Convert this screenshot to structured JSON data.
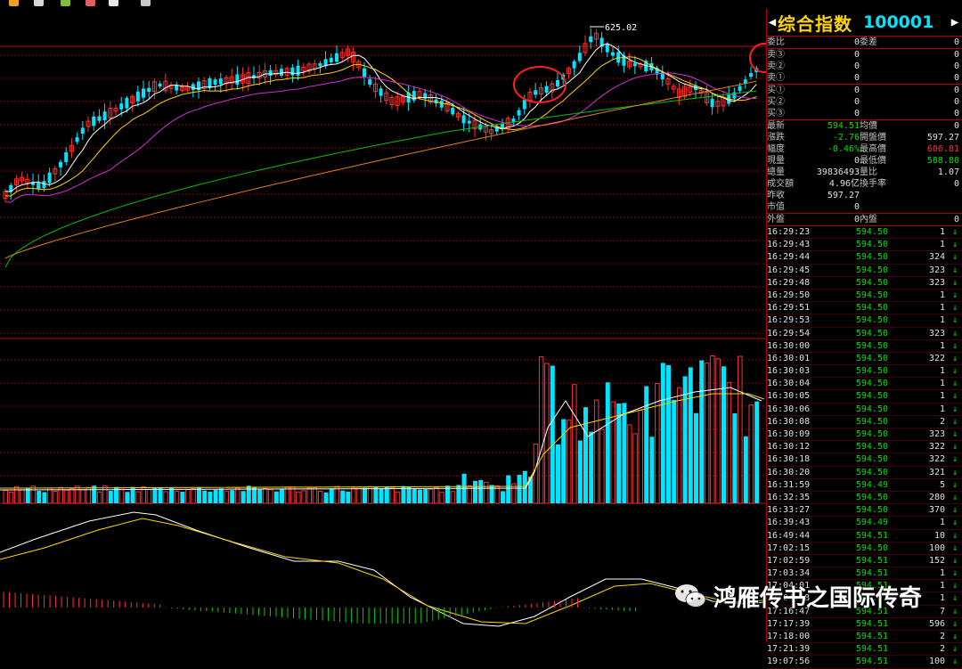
{
  "toolbar": {
    "icons": [
      "alert-icon",
      "file-icon",
      "pen-icon",
      "highlighter-icon",
      "edit-icon",
      "gear-icon"
    ]
  },
  "chart": {
    "peak_label": "625.02",
    "colors": {
      "up": "#ff3030",
      "down": "#00e5ff",
      "grid": "#8a0000",
      "ma5": "#ffffff",
      "ma10": "#ffd400",
      "ma20": "#d030d0",
      "ma60": "#00c000",
      "ma120": "#e08020"
    }
  },
  "panel": {
    "title": "综合指数",
    "code": "100001",
    "order_ratio": {
      "label": "委比",
      "value": "0",
      "label2": "委差",
      "value2": "0"
    },
    "sells": [
      {
        "label": "卖③",
        "value": "0",
        "extra": "0"
      },
      {
        "label": "卖②",
        "value": "0",
        "extra": "0"
      },
      {
        "label": "卖①",
        "value": "0",
        "extra": "0"
      }
    ],
    "buys": [
      {
        "label": "买①",
        "value": "0",
        "extra": "0"
      },
      {
        "label": "买②",
        "value": "0",
        "extra": "0"
      },
      {
        "label": "买③",
        "value": "0",
        "extra": "0"
      }
    ],
    "quote": [
      {
        "l1": "最新",
        "v1": "594.51",
        "l2": "均價",
        "v2": "0",
        "c1": "grn",
        "c2": "wht"
      },
      {
        "l1": "漲跌",
        "v1": "-2.76",
        "l2": "開盤價",
        "v2": "597.27",
        "c1": "grn",
        "c2": "wht"
      },
      {
        "l1": "幅度",
        "v1": "-0.46%",
        "l2": "最高價",
        "v2": "606.81",
        "c1": "grn",
        "c2": "red"
      },
      {
        "l1": "現量",
        "v1": "0",
        "l2": "最低價",
        "v2": "588.80",
        "c1": "wht",
        "c2": "grn"
      },
      {
        "l1": "總量",
        "v1": "39836493",
        "l2": "量比",
        "v2": "1.07",
        "c1": "wht",
        "c2": "wht"
      },
      {
        "l1": "成交額",
        "v1": "4.96亿",
        "l2": "換手率",
        "v2": "0",
        "c1": "wht",
        "c2": "wht"
      },
      {
        "l1": "昨收",
        "v1": "597.27",
        "l2": "",
        "v2": "",
        "c1": "wht",
        "c2": "wht"
      },
      {
        "l1": "市值",
        "v1": "0",
        "l2": "",
        "v2": "",
        "c1": "wht",
        "c2": "wht"
      }
    ],
    "outer": {
      "label": "外盤",
      "value": "0",
      "label2": "內盤",
      "value2": "0"
    },
    "ticks": [
      {
        "time": "16:29:23",
        "price": "594.50",
        "vol": "1"
      },
      {
        "time": "16:29:43",
        "price": "594.50",
        "vol": "1"
      },
      {
        "time": "16:29:44",
        "price": "594.50",
        "vol": "324"
      },
      {
        "time": "16:29:45",
        "price": "594.50",
        "vol": "323"
      },
      {
        "time": "16:29:48",
        "price": "594.50",
        "vol": "323"
      },
      {
        "time": "16:29:50",
        "price": "594.50",
        "vol": "1"
      },
      {
        "time": "16:29:51",
        "price": "594.50",
        "vol": "1"
      },
      {
        "time": "16:29:53",
        "price": "594.50",
        "vol": "1"
      },
      {
        "time": "16:29:54",
        "price": "594.50",
        "vol": "323"
      },
      {
        "time": "16:30:00",
        "price": "594.50",
        "vol": "1"
      },
      {
        "time": "16:30:01",
        "price": "594.50",
        "vol": "322"
      },
      {
        "time": "16:30:03",
        "price": "594.50",
        "vol": "1"
      },
      {
        "time": "16:30:04",
        "price": "594.50",
        "vol": "1"
      },
      {
        "time": "16:30:05",
        "price": "594.50",
        "vol": "1"
      },
      {
        "time": "16:30:06",
        "price": "594.50",
        "vol": "1"
      },
      {
        "time": "16:30:08",
        "price": "594.50",
        "vol": "2"
      },
      {
        "time": "16:30:09",
        "price": "594.50",
        "vol": "323"
      },
      {
        "time": "16:30:12",
        "price": "594.50",
        "vol": "322"
      },
      {
        "time": "16:30:18",
        "price": "594.50",
        "vol": "322"
      },
      {
        "time": "16:30:20",
        "price": "594.50",
        "vol": "321"
      },
      {
        "time": "16:31:59",
        "price": "594.49",
        "vol": "5"
      },
      {
        "time": "16:32:35",
        "price": "594.50",
        "vol": "280"
      },
      {
        "time": "16:33:27",
        "price": "594.50",
        "vol": "370"
      },
      {
        "time": "16:39:43",
        "price": "594.49",
        "vol": "1"
      },
      {
        "time": "16:49:44",
        "price": "594.51",
        "vol": "10"
      },
      {
        "time": "17:02:15",
        "price": "594.50",
        "vol": "100"
      },
      {
        "time": "17:02:59",
        "price": "594.51",
        "vol": "152"
      },
      {
        "time": "17:03:34",
        "price": "594.51",
        "vol": "1"
      },
      {
        "time": "17:04:01",
        "price": "594.51",
        "vol": "1"
      },
      {
        "time": "17:04:18",
        "price": "594.51",
        "vol": "1"
      },
      {
        "time": "17:16:47",
        "price": "594.51",
        "vol": "7"
      },
      {
        "time": "17:17:39",
        "price": "594.51",
        "vol": "596"
      },
      {
        "time": "17:18:00",
        "price": "594.51",
        "vol": "2"
      },
      {
        "time": "17:21:39",
        "price": "594.51",
        "vol": "2"
      },
      {
        "time": "19:07:56",
        "price": "594.51",
        "vol": "100"
      }
    ],
    "down_arrow": "↓"
  },
  "watermark": {
    "text": "鸿雁传书之国际传奇"
  }
}
